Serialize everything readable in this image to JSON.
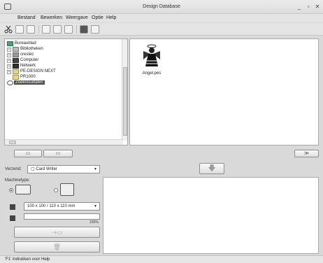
{
  "window": {
    "title": "Design Database"
  },
  "menu": [
    "Bestand",
    "Bewerken",
    "Weergave",
    "Optie",
    "Help"
  ],
  "tree": {
    "items": [
      {
        "label": "Bureaublad"
      },
      {
        "label": "Bibliotheken"
      },
      {
        "label": "crestec"
      },
      {
        "label": "Computer"
      },
      {
        "label": "Netwerk"
      },
      {
        "label": "PE-DESIGN NEXT"
      },
      {
        "label": "PR1000"
      },
      {
        "label": "Zoekresultaten"
      }
    ]
  },
  "files": [
    {
      "name": "Angel.pes"
    }
  ],
  "lower": {
    "send_label": "Verzend:",
    "send_value": "Card Writer",
    "machine_label": "Machinetype:",
    "hoop_value": "100 x 100 / 110 x 110 mm",
    "progress_label": "100%",
    "progress": 1.0
  },
  "status": {
    "text": "'F1' indrukken voor Help"
  },
  "colors": {
    "accent": "#4a4a4a",
    "background": "#d9d9d9"
  }
}
